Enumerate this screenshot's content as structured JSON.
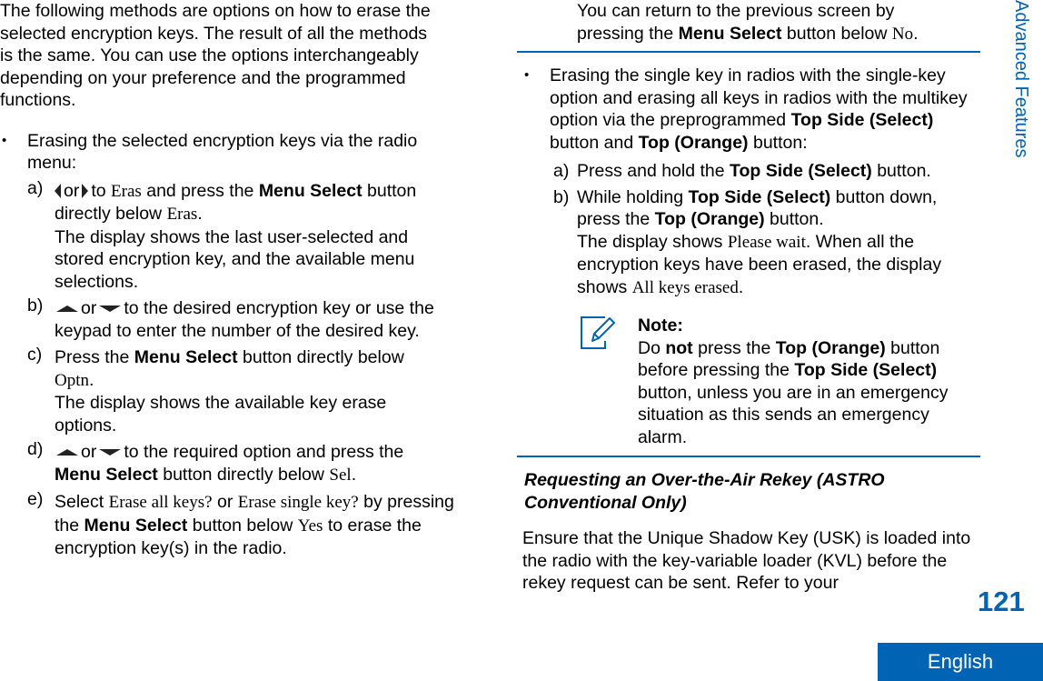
{
  "left": {
    "intro": "The following methods are options on how to erase the selected encryption keys. The result of all the methods is the same. You can use the options interchangeably depending on your preference and the programmed functions.",
    "bullet1": {
      "marker": "•",
      "text": "Erasing the selected encryption keys via the radio menu:",
      "steps": [
        {
          "label": "a)",
          "t1": "or",
          "t2": "to",
          "s1": "Eras",
          "t3": "and press the",
          "b1": "Menu Select",
          "t4": "button directly below",
          "s2": "Eras",
          "t5": ".",
          "result": "The display shows the last user-selected and stored encryption key, and the available menu selections."
        },
        {
          "label": "b)",
          "t1": "or",
          "t2": "to the desired encryption key or use the keypad to enter the number of the desired key."
        },
        {
          "label": "c)",
          "t1": "Press the",
          "b1": "Menu Select",
          "t2": "button directly below",
          "s1": "Optn",
          "t3": ".",
          "result": "The display shows the available key erase options."
        },
        {
          "label": "d)",
          "t1": "or",
          "t2": "to the required option and press the",
          "b1": "Menu Select",
          "t3": "button directly below",
          "s1": "Sel",
          "t4": "."
        },
        {
          "label": "e)",
          "t1": "Select",
          "s1": "Erase all keys?",
          "t2": "or",
          "s2": "Erase single key?",
          "t3": "by pressing the",
          "b1": "Menu Select",
          "t4": "button below",
          "s3": "Yes",
          "t5": "to erase the encryption key(s) in the radio."
        }
      ]
    }
  },
  "right": {
    "cont": {
      "t1": "You can return to the previous screen by pressing the",
      "b1": "Menu Select",
      "t2": "button below",
      "s1": "No",
      "t3": "."
    },
    "bullet2": {
      "marker": "•",
      "t1": "Erasing the single key in radios with the single-key option and erasing all keys in radios with the multikey option via the preprogrammed",
      "b1": "Top Side (Select)",
      "t2": "button and",
      "b2": "Top (Orange)",
      "t3": "button:",
      "steps": [
        {
          "label": "a)",
          "t1": "Press and hold the",
          "b1": "Top Side (Select)",
          "t2": "button."
        },
        {
          "label": "b)",
          "t1": "While holding",
          "b1": "Top Side (Select)",
          "t2": "button down, press the",
          "b2": "Top (Orange)",
          "t3": "button.",
          "r1": "The display shows",
          "s1": "Please wait",
          "r2": ". When all the encryption keys have been erased, the display shows",
          "s2": "All keys erased",
          "r3": "."
        }
      ]
    },
    "note": {
      "title": "Note:",
      "t1": "Do",
      "b1": "not",
      "t2": "press the",
      "b2": "Top (Orange)",
      "t3": "button before pressing the",
      "b3": "Top Side (Select)",
      "t4": "button, unless you are in an emergency situation as this sends an emergency alarm."
    },
    "heading": "Requesting an Over-the-Air Rekey (ASTRO Conventional Only)",
    "para": "Ensure that the Unique Shadow Key (USK) is loaded into the radio with the key-variable loader (KVL) before the rekey request can be sent. Refer to your"
  },
  "side": {
    "title": "Advanced Features",
    "page_number": "121",
    "language": "English"
  },
  "colors": {
    "accent": "#0063b4"
  }
}
